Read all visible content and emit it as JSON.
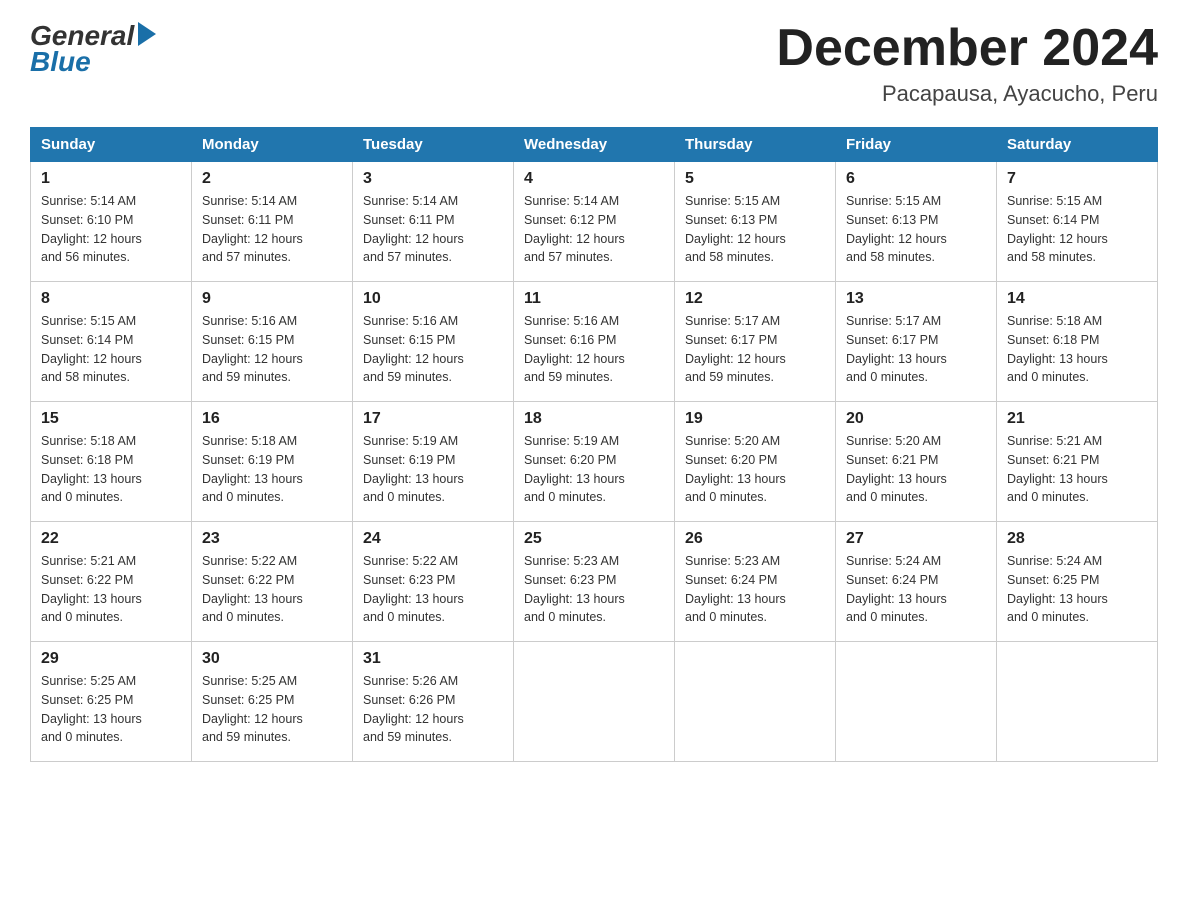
{
  "logo": {
    "general": "General",
    "blue": "Blue"
  },
  "title": "December 2024",
  "location": "Pacapausa, Ayacucho, Peru",
  "days_of_week": [
    "Sunday",
    "Monday",
    "Tuesday",
    "Wednesday",
    "Thursday",
    "Friday",
    "Saturday"
  ],
  "weeks": [
    [
      {
        "day": "1",
        "sunrise": "5:14 AM",
        "sunset": "6:10 PM",
        "daylight": "12 hours and 56 minutes."
      },
      {
        "day": "2",
        "sunrise": "5:14 AM",
        "sunset": "6:11 PM",
        "daylight": "12 hours and 57 minutes."
      },
      {
        "day": "3",
        "sunrise": "5:14 AM",
        "sunset": "6:11 PM",
        "daylight": "12 hours and 57 minutes."
      },
      {
        "day": "4",
        "sunrise": "5:14 AM",
        "sunset": "6:12 PM",
        "daylight": "12 hours and 57 minutes."
      },
      {
        "day": "5",
        "sunrise": "5:15 AM",
        "sunset": "6:13 PM",
        "daylight": "12 hours and 58 minutes."
      },
      {
        "day": "6",
        "sunrise": "5:15 AM",
        "sunset": "6:13 PM",
        "daylight": "12 hours and 58 minutes."
      },
      {
        "day": "7",
        "sunrise": "5:15 AM",
        "sunset": "6:14 PM",
        "daylight": "12 hours and 58 minutes."
      }
    ],
    [
      {
        "day": "8",
        "sunrise": "5:15 AM",
        "sunset": "6:14 PM",
        "daylight": "12 hours and 58 minutes."
      },
      {
        "day": "9",
        "sunrise": "5:16 AM",
        "sunset": "6:15 PM",
        "daylight": "12 hours and 59 minutes."
      },
      {
        "day": "10",
        "sunrise": "5:16 AM",
        "sunset": "6:15 PM",
        "daylight": "12 hours and 59 minutes."
      },
      {
        "day": "11",
        "sunrise": "5:16 AM",
        "sunset": "6:16 PM",
        "daylight": "12 hours and 59 minutes."
      },
      {
        "day": "12",
        "sunrise": "5:17 AM",
        "sunset": "6:17 PM",
        "daylight": "12 hours and 59 minutes."
      },
      {
        "day": "13",
        "sunrise": "5:17 AM",
        "sunset": "6:17 PM",
        "daylight": "13 hours and 0 minutes."
      },
      {
        "day": "14",
        "sunrise": "5:18 AM",
        "sunset": "6:18 PM",
        "daylight": "13 hours and 0 minutes."
      }
    ],
    [
      {
        "day": "15",
        "sunrise": "5:18 AM",
        "sunset": "6:18 PM",
        "daylight": "13 hours and 0 minutes."
      },
      {
        "day": "16",
        "sunrise": "5:18 AM",
        "sunset": "6:19 PM",
        "daylight": "13 hours and 0 minutes."
      },
      {
        "day": "17",
        "sunrise": "5:19 AM",
        "sunset": "6:19 PM",
        "daylight": "13 hours and 0 minutes."
      },
      {
        "day": "18",
        "sunrise": "5:19 AM",
        "sunset": "6:20 PM",
        "daylight": "13 hours and 0 minutes."
      },
      {
        "day": "19",
        "sunrise": "5:20 AM",
        "sunset": "6:20 PM",
        "daylight": "13 hours and 0 minutes."
      },
      {
        "day": "20",
        "sunrise": "5:20 AM",
        "sunset": "6:21 PM",
        "daylight": "13 hours and 0 minutes."
      },
      {
        "day": "21",
        "sunrise": "5:21 AM",
        "sunset": "6:21 PM",
        "daylight": "13 hours and 0 minutes."
      }
    ],
    [
      {
        "day": "22",
        "sunrise": "5:21 AM",
        "sunset": "6:22 PM",
        "daylight": "13 hours and 0 minutes."
      },
      {
        "day": "23",
        "sunrise": "5:22 AM",
        "sunset": "6:22 PM",
        "daylight": "13 hours and 0 minutes."
      },
      {
        "day": "24",
        "sunrise": "5:22 AM",
        "sunset": "6:23 PM",
        "daylight": "13 hours and 0 minutes."
      },
      {
        "day": "25",
        "sunrise": "5:23 AM",
        "sunset": "6:23 PM",
        "daylight": "13 hours and 0 minutes."
      },
      {
        "day": "26",
        "sunrise": "5:23 AM",
        "sunset": "6:24 PM",
        "daylight": "13 hours and 0 minutes."
      },
      {
        "day": "27",
        "sunrise": "5:24 AM",
        "sunset": "6:24 PM",
        "daylight": "13 hours and 0 minutes."
      },
      {
        "day": "28",
        "sunrise": "5:24 AM",
        "sunset": "6:25 PM",
        "daylight": "13 hours and 0 minutes."
      }
    ],
    [
      {
        "day": "29",
        "sunrise": "5:25 AM",
        "sunset": "6:25 PM",
        "daylight": "13 hours and 0 minutes."
      },
      {
        "day": "30",
        "sunrise": "5:25 AM",
        "sunset": "6:25 PM",
        "daylight": "12 hours and 59 minutes."
      },
      {
        "day": "31",
        "sunrise": "5:26 AM",
        "sunset": "6:26 PM",
        "daylight": "12 hours and 59 minutes."
      },
      null,
      null,
      null,
      null
    ]
  ],
  "labels": {
    "sunrise": "Sunrise:",
    "sunset": "Sunset:",
    "daylight": "Daylight:"
  }
}
